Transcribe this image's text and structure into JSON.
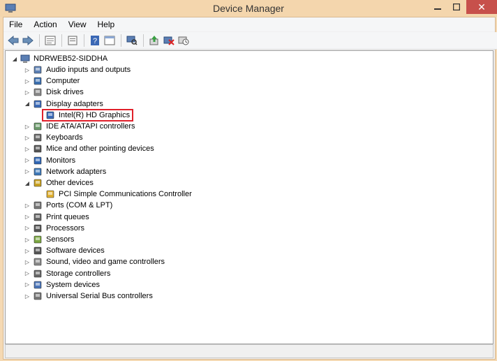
{
  "window": {
    "title": "Device Manager",
    "close_glyph": "✕"
  },
  "menu": [
    "File",
    "Action",
    "View",
    "Help"
  ],
  "toolbar_icons": [
    "back-arrow-icon",
    "forward-arrow-icon",
    "properties-icon",
    "update-list-icon",
    "help-icon",
    "console-tree-icon",
    "scan-hardware-icon",
    "update-driver-icon",
    "uninstall-icon",
    "disable-device-icon"
  ],
  "tree": {
    "root": "NDRWEB52-SIDDHA",
    "categories": [
      {
        "label": "Audio inputs and outputs",
        "icon": "speaker-icon"
      },
      {
        "label": "Computer",
        "icon": "computer-icon"
      },
      {
        "label": "Disk drives",
        "icon": "disk-drive-icon"
      },
      {
        "label": "Display adapters",
        "icon": "display-adapter-icon",
        "expanded": true,
        "children": [
          "Intel(R) HD Graphics"
        ]
      },
      {
        "label": "IDE ATA/ATAPI controllers",
        "icon": "ide-controller-icon"
      },
      {
        "label": "Keyboards",
        "icon": "keyboard-icon"
      },
      {
        "label": "Mice and other pointing devices",
        "icon": "mouse-icon"
      },
      {
        "label": "Monitors",
        "icon": "monitor-icon"
      },
      {
        "label": "Network adapters",
        "icon": "network-adapter-icon"
      },
      {
        "label": "Other devices",
        "icon": "unknown-device-icon",
        "expanded": true,
        "children": [
          "PCI Simple Communications Controller"
        ]
      },
      {
        "label": "Ports (COM & LPT)",
        "icon": "port-icon"
      },
      {
        "label": "Print queues",
        "icon": "printer-icon"
      },
      {
        "label": "Processors",
        "icon": "processor-icon"
      },
      {
        "label": "Sensors",
        "icon": "sensor-icon"
      },
      {
        "label": "Software devices",
        "icon": "software-device-icon"
      },
      {
        "label": "Sound, video and game controllers",
        "icon": "sound-icon"
      },
      {
        "label": "Storage controllers",
        "icon": "storage-controller-icon"
      },
      {
        "label": "System devices",
        "icon": "system-device-icon"
      },
      {
        "label": "Universal Serial Bus controllers",
        "icon": "usb-icon"
      }
    ]
  },
  "colors": {
    "titlebar": "#f4d6ad",
    "close": "#c7504b",
    "highlight": "#e0202a"
  }
}
